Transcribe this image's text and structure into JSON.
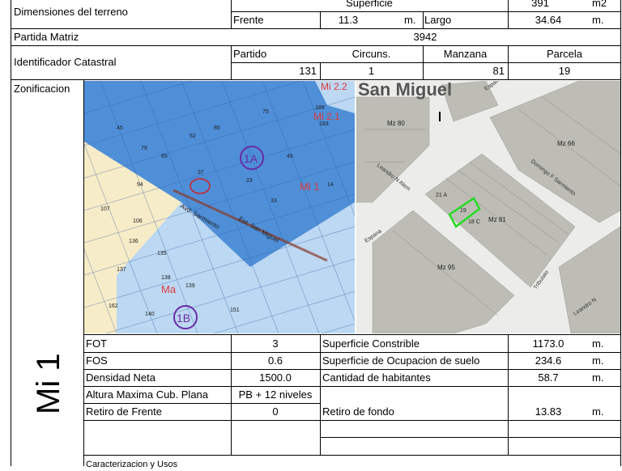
{
  "header": {
    "dimensiones_label": "Dimensiones del terreno",
    "superficie_label": "Superficie",
    "superficie_value": "391",
    "superficie_unit": "m2",
    "frente_label": "Frente",
    "frente_value": "11.3",
    "frente_unit": "m.",
    "largo_label": "Largo",
    "largo_value": "34.64",
    "largo_unit": "m.",
    "partida_label": "Partida Matriz",
    "partida_value": "3942",
    "identificador_label": "Identificador Catastral",
    "partido_label": "Partido",
    "partido_value": "131",
    "circuns_label": "Circuns.",
    "circuns_value": "1",
    "manzana_label": "Manzana",
    "manzana_value": "81",
    "parcela_label": "Parcela",
    "parcela_value": "19"
  },
  "zonificacion": {
    "label": "Zonificacion",
    "zone_code": "Mi 1"
  },
  "map_left": {
    "labels": {
      "mi22": "Mi 2.2",
      "mi21": "Mi 2.1",
      "mi1": "Mi 1",
      "ma": "Ma",
      "zone_1a": "1A",
      "zone_1b": "1B",
      "street_sarmiento": "Avd. Sarmiento",
      "street_san_miguel": "Est. San Miguel"
    }
  },
  "map_right": {
    "labels": {
      "town": "San Miguel",
      "mz80": "Mz 80",
      "mz66": "Mz 66",
      "mz81": "Mz 81",
      "mz95": "Mz 95",
      "street_espana_top": "Espana",
      "street_espana_bottom": "Espana",
      "street_domingo": "Domingo F Sarmiento",
      "street_leandro": "Leandro N Alem",
      "street_leandro2": "Leandro N",
      "street_tribulato": "Tribulato",
      "parcel_19": "19",
      "parcel_21a": "21 A",
      "parcel_18c": "18 C"
    }
  },
  "indicators": {
    "fot_label": "FOT",
    "fot_value": "3",
    "fos_label": "FOS",
    "fos_value": "0.6",
    "densidad_label": "Densidad Neta",
    "densidad_value": "1500.0",
    "altura_label": "Altura Maxima Cub. Plana",
    "altura_value": "PB + 12 niveles",
    "retiro_frente_label": "Retiro de Frente",
    "retiro_frente_value": "0",
    "sup_constrible_label": "Superficie Constrible",
    "sup_constrible_value": "1173.0",
    "sup_constrible_unit": "m.",
    "sup_ocupacion_label": "Superficie de Ocupacion de suelo",
    "sup_ocupacion_value": "234.6",
    "sup_ocupacion_unit": "m.",
    "habitantes_label": "Cantidad de habitantes",
    "habitantes_value": "58.7",
    "habitantes_unit": "m.",
    "retiro_fondo_label": "Retiro de fondo",
    "retiro_fondo_value": "13.83",
    "retiro_fondo_unit": "m."
  },
  "footer": {
    "caracterizacion_label": "Caracterizacion y Usos"
  },
  "colors": {
    "zone_blue": "#4f8fd8",
    "zone_light_blue": "#bcd8f2",
    "zone_yellow": "#f7ecc8",
    "zone_red_text": "#e03a3a",
    "zone_purple": "#6a2aa8",
    "map_gray": "#bdbdb5",
    "highlight_green": "#22dd22"
  }
}
